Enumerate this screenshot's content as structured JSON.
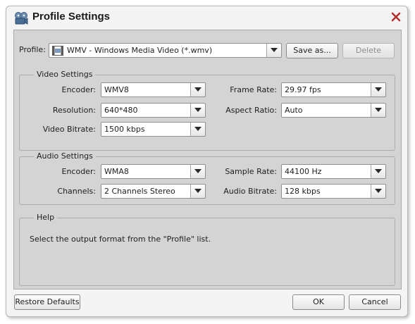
{
  "window": {
    "title": "Profile Settings",
    "icon": "film-reel-icon",
    "close_icon": "close-x-icon"
  },
  "profile": {
    "label": "Profile:",
    "value": "WMV - Windows Media Video (*.wmv)",
    "value_icon": "wmv-file-icon",
    "save_as_label": "Save as...",
    "delete_label": "Delete"
  },
  "video": {
    "title": "Video Settings",
    "encoder": {
      "label": "Encoder:",
      "value": "WMV8"
    },
    "resolution": {
      "label": "Resolution:",
      "value": "640*480"
    },
    "bitrate": {
      "label": "Video Bitrate:",
      "value": "1500 kbps"
    },
    "frame_rate": {
      "label": "Frame Rate:",
      "value": "29.97 fps"
    },
    "aspect_ratio": {
      "label": "Aspect Ratio:",
      "value": "Auto"
    }
  },
  "audio": {
    "title": "Audio Settings",
    "encoder": {
      "label": "Encoder:",
      "value": "WMA8"
    },
    "channels": {
      "label": "Channels:",
      "value": "2 Channels Stereo"
    },
    "sample_rate": {
      "label": "Sample Rate:",
      "value": "44100 Hz"
    },
    "bitrate": {
      "label": "Audio Bitrate:",
      "value": "128 kbps"
    }
  },
  "help": {
    "title": "Help",
    "text": "Select the output format from the \"Profile\" list."
  },
  "footer": {
    "restore_label": "Restore Defaults",
    "ok_label": "OK",
    "cancel_label": "Cancel"
  },
  "colors": {
    "window_bg": "#f4f4f4",
    "panel_bg": "#d4d4d4",
    "close_red": "#b03030",
    "border": "#8f8f8f"
  }
}
